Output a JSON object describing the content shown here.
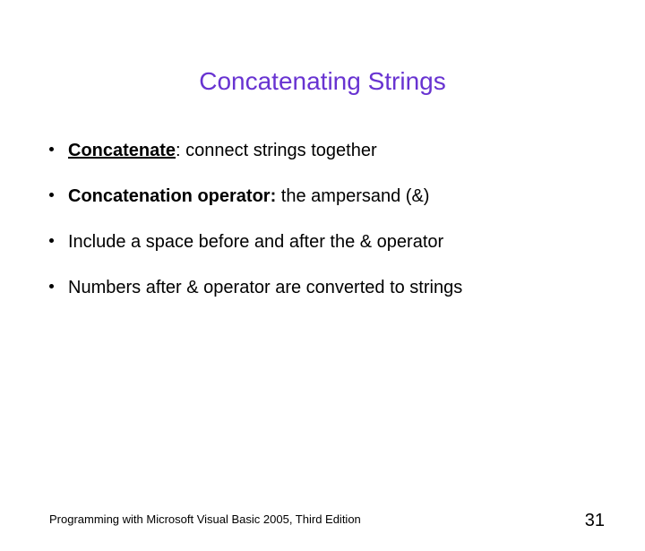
{
  "title": "Concatenating Strings",
  "bullets": {
    "b1_strong": "Concatenate",
    "b1_rest": ": connect strings together",
    "b2_strong": "Concatenation operator:",
    "b2_rest": " the ampersand (&)",
    "b3": "Include a space before and after the & operator",
    "b4": "Numbers after & operator are converted to strings"
  },
  "footer": "Programming with Microsoft Visual Basic 2005, Third Edition",
  "page_number": "31"
}
